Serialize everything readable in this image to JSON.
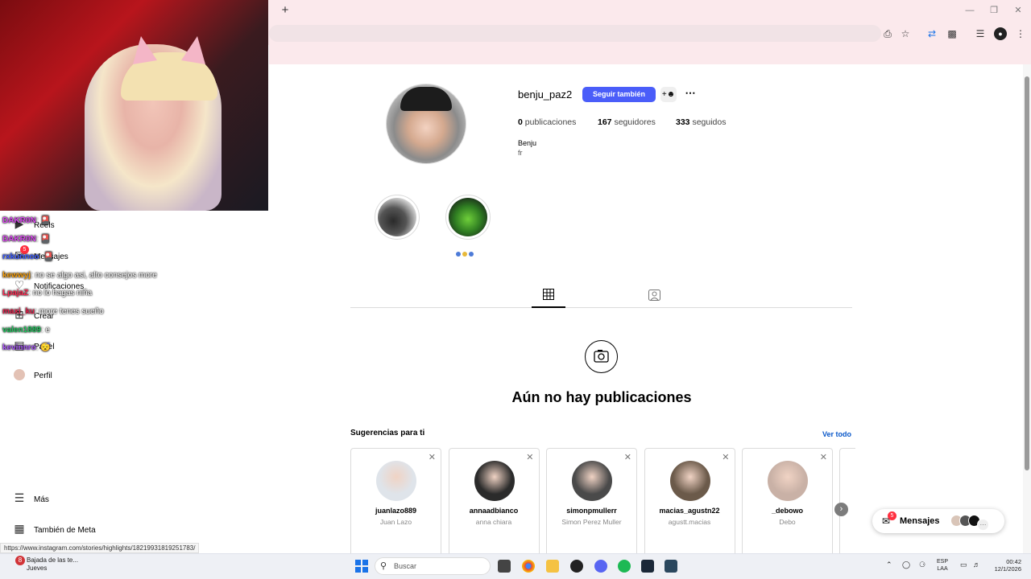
{
  "browser": {
    "newtab_icon": "plus-icon",
    "toolbar_icons": [
      "install-app-icon",
      "star-icon",
      "translate-icon",
      "extensions-icon",
      "reading-list-icon",
      "profile-icon",
      "kebab-menu-icon"
    ],
    "status_url": "https://www.instagram.com/stories/highlights/18219931819251783/"
  },
  "sidebar": {
    "items": [
      {
        "label": "Reels",
        "icon": "reels-icon"
      },
      {
        "label": "Mensajes",
        "icon": "messenger-icon",
        "badge": "5"
      },
      {
        "label": "Notificaciones",
        "icon": "heart-icon"
      },
      {
        "label": "Crear",
        "icon": "plus-square-icon"
      },
      {
        "label": "Panel",
        "icon": "dashboard-icon"
      },
      {
        "label": "Perfil",
        "icon": "avatar"
      }
    ],
    "more_label": "Más",
    "meta_label": "También de Meta"
  },
  "chat": [
    {
      "user": "DAKR0N",
      "color": "#d946ef",
      "msg": ":  🎴"
    },
    {
      "user": "DAKR0N",
      "color": "#d946ef",
      "msg": ":  🎴"
    },
    {
      "user": "rxkunnoo",
      "color": "#3b5bff",
      "msg": ":  🎴"
    },
    {
      "user": "kewwyj",
      "color": "#f59e0b",
      "msg": ": no se algo asi, alto consejos more"
    },
    {
      "user": "LpajaZ",
      "color": "#ff2d55",
      "msg": ": no lo hagas niña"
    },
    {
      "user": "maxi_ku",
      "color": "#e11d48",
      "msg": ": more tenes sueño"
    },
    {
      "user": "valen1889",
      "color": "#22c55e",
      "msg": ": e"
    },
    {
      "user": "kevinnro",
      "color": "#a855f7",
      "msg": ":  😴"
    }
  ],
  "profile": {
    "username": "benju_paz2",
    "follow_button": "Seguir también",
    "add_user_icon": "add-user-icon",
    "more_icon": "ellipsis-icon",
    "posts_count": "0",
    "posts_label": "publicaciones",
    "followers_count": "167",
    "followers_label": "seguidores",
    "following_count": "333",
    "following_label": "seguidos",
    "full_name": "Benju",
    "bio": "fr"
  },
  "tabs": [
    {
      "icon": "grid-icon",
      "active": true
    },
    {
      "icon": "tagged-icon",
      "active": false
    }
  ],
  "empty_state": {
    "icon": "camera-icon",
    "title": "Aún no hay publicaciones"
  },
  "suggestions": {
    "title": "Sugerencias para ti",
    "see_all": "Ver todo",
    "cards": [
      {
        "username": "juanlazo889",
        "name": "Juan Lazo",
        "color": "#dfe4ea"
      },
      {
        "username": "annaadbianco",
        "name": "anna chiara",
        "color": "#2b2b2b"
      },
      {
        "username": "simonpmullerr",
        "name": "Simon Perez Muller",
        "color": "#4a4a4a"
      },
      {
        "username": "macias_agustn22",
        "name": "agustt.macias",
        "color": "#6b5a4a"
      },
      {
        "username": "_debowo",
        "name": "Debo",
        "color": "#c9b1a6"
      }
    ]
  },
  "messages": {
    "label": "Mensajes",
    "badge": "5"
  },
  "taskbar": {
    "weather_title": "Bajada de las te...",
    "weather_sub": "Jueves",
    "weather_badge": "8",
    "search_label": "Buscar",
    "lang_top": "ESP",
    "lang_bottom": "LAA",
    "time": "00:42",
    "date": "12/1/2026"
  }
}
